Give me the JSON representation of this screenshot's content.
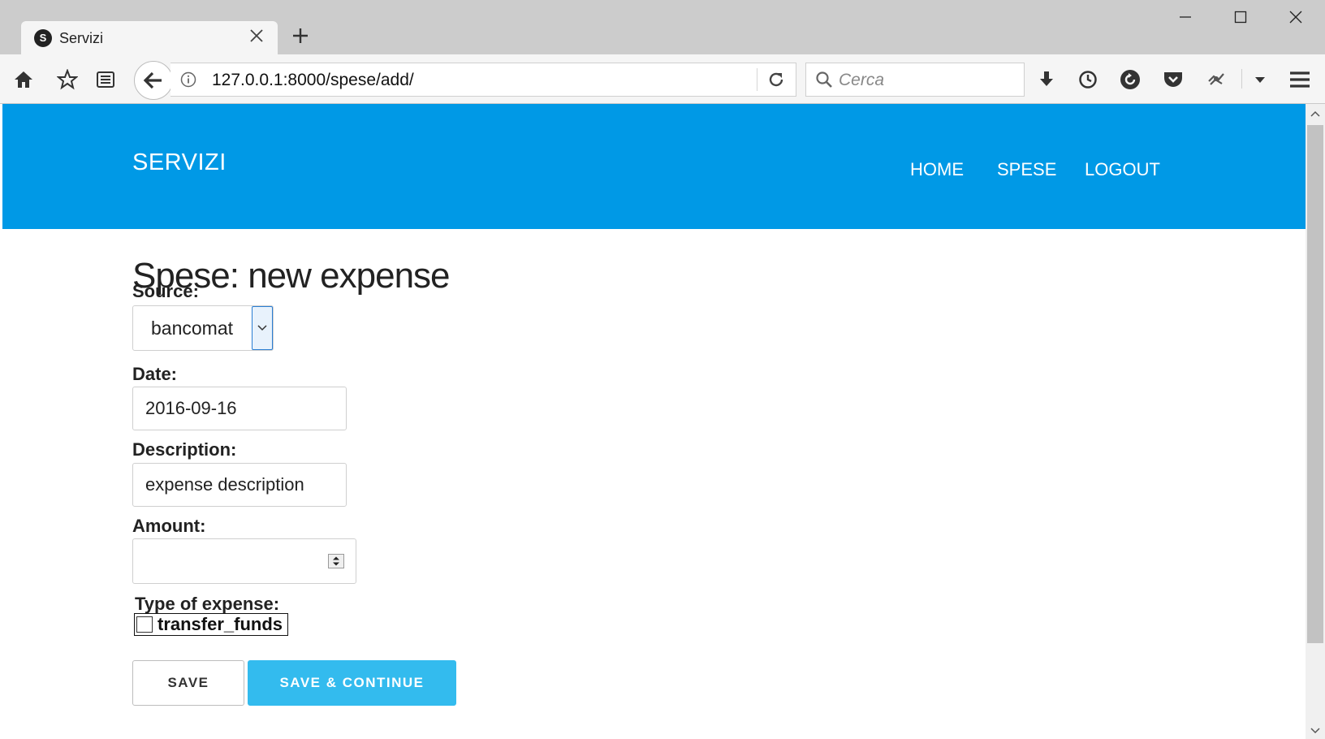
{
  "browser": {
    "tab_title": "Servizi",
    "tab_favicon_letter": "S",
    "url": "127.0.0.1:8000/spese/add/",
    "search_placeholder": "Cerca"
  },
  "site": {
    "brand": "SERVIZI",
    "nav": [
      "HOME",
      "SPESE",
      "LOGOUT"
    ],
    "header_color": "#0099e6"
  },
  "form": {
    "title": "Spese: new expense",
    "source": {
      "label": "Source:",
      "selected": "bancomat"
    },
    "date": {
      "label": "Date:",
      "value": "2016-09-16"
    },
    "description": {
      "label": "Description:",
      "value": "expense description"
    },
    "amount": {
      "label": "Amount:",
      "value": ""
    },
    "type": {
      "label": "Type of expense:",
      "option_label": "transfer_funds",
      "checked": false
    },
    "buttons": {
      "save": "SAVE",
      "save_continue": "SAVE & CONTINUE"
    },
    "accent_color": "#33bbee"
  }
}
